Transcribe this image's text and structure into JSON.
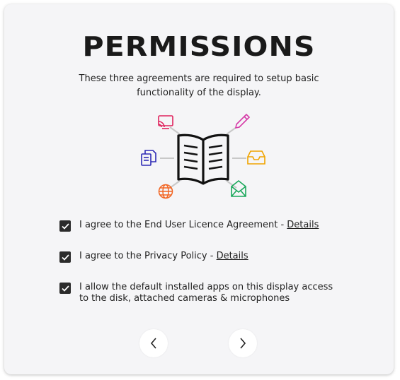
{
  "title": "PERMISSIONS",
  "subtitle": "These three agreements are required to setup basic functionality of the display.",
  "illustration": {
    "icons": [
      "cast-icon",
      "pencil-icon",
      "documents-icon",
      "inbox-icon",
      "globe-icon",
      "mail-icon",
      "open-book-icon"
    ],
    "colors": {
      "cast": "#e0245e",
      "pencil": "#d63ba8",
      "documents": "#2e2bb5",
      "inbox": "#f0a400",
      "globe": "#f26522",
      "mail": "#1aa85b",
      "book": "#111111"
    }
  },
  "agreements": [
    {
      "text": "I agree to the End User Licence Agreement - ",
      "link": "Details",
      "checked": true
    },
    {
      "text": "I agree to the Privacy Policy - ",
      "link": "Details",
      "checked": true
    },
    {
      "text": "I allow the default installed apps on this display access to the disk, attached cameras & microphones",
      "link": "",
      "checked": true
    }
  ],
  "nav": {
    "prev_icon": "chevron-left-icon",
    "next_icon": "chevron-right-icon"
  }
}
